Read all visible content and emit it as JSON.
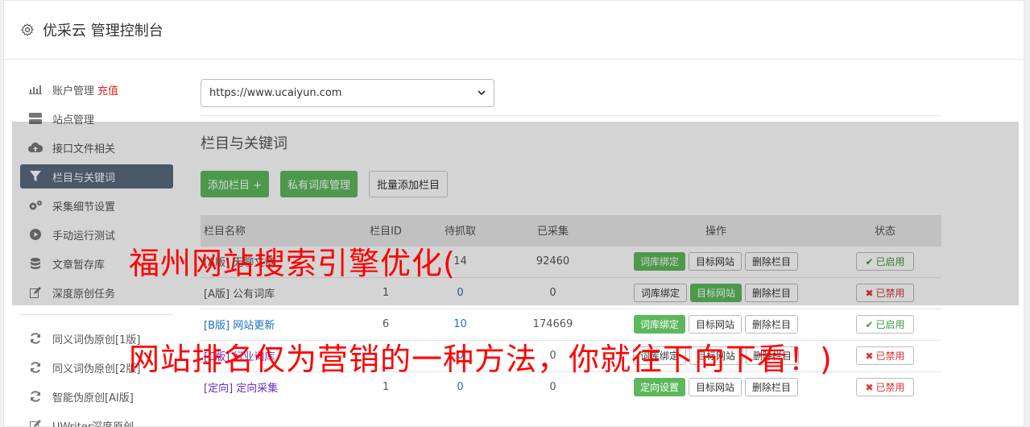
{
  "header": {
    "icon": "gear-icon",
    "title": "优采云 管理控制台"
  },
  "sidebar": {
    "items": [
      {
        "icon": "bar-chart-icon",
        "label": "账户管理",
        "accent": "充值",
        "active": false
      },
      {
        "icon": "server-icon",
        "label": "站点管理",
        "active": false
      },
      {
        "icon": "cloud-upload-icon",
        "label": "接口文件相关",
        "active": false
      },
      {
        "icon": "filter-icon",
        "label": "栏目与关键词",
        "active": true
      },
      {
        "icon": "cogs-icon",
        "label": "采集细节设置",
        "active": false
      },
      {
        "icon": "play-circle-icon",
        "label": "手动运行测试",
        "active": false
      },
      {
        "icon": "database-icon",
        "label": "文章暂存库",
        "active": false
      },
      {
        "icon": "edit-icon",
        "label": "深度原创任务",
        "active": false
      }
    ],
    "tools": [
      {
        "icon": "refresh-icon",
        "label": "同义词伪原创[1版]"
      },
      {
        "icon": "refresh-icon",
        "label": "同义词伪原创[2版]"
      },
      {
        "icon": "refresh-icon",
        "label": "智能伪原创[AI版]"
      },
      {
        "icon": "edit-icon",
        "label": "UWriter深度原创"
      }
    ]
  },
  "main": {
    "site_select": "https://www.ucaiyun.com",
    "section_title": "栏目与关键词",
    "buttons": {
      "add": "添加栏目 +",
      "private_lib": "私有词库管理",
      "batch_add": "批量添加栏目"
    },
    "table": {
      "headers": [
        "栏目名称",
        "栏目ID",
        "待抓取",
        "已采集",
        "操作",
        "状态"
      ],
      "rows": [
        {
          "name": "[A版] 无聊文章",
          "id": "",
          "pending": "14",
          "collected": "92460",
          "op1": "词库绑定",
          "op1_green": true,
          "op2": "目标网站",
          "op2_green": false,
          "op3": "删除栏目",
          "status": "已启用",
          "status_on": true,
          "name_color": "gray"
        },
        {
          "name": "[A版] 公有词库",
          "id": "1",
          "pending": "0",
          "collected": "0",
          "op1": "词库绑定",
          "op1_green": false,
          "op2": "目标网站",
          "op2_green": true,
          "op3": "删除栏目",
          "status": "已禁用",
          "status_on": false,
          "name_color": "gray"
        },
        {
          "name": "[B版] 网站更新",
          "id": "6",
          "pending": "10",
          "collected": "174669",
          "op1": "词库绑定",
          "op1_green": true,
          "op2": "目标网站",
          "op2_green": false,
          "op3": "删除栏目",
          "status": "已启用",
          "status_on": true,
          "name_color": "blue"
        },
        {
          "name": "[C版] 行业词库",
          "id": "",
          "pending": "0",
          "collected": "0",
          "op1": "词库绑定",
          "op1_green": false,
          "op2": "目标网站",
          "op2_green": false,
          "op3": "删除栏目",
          "status": "已禁用",
          "status_on": false,
          "name_color": "purple"
        },
        {
          "name": "[定向] 定向采集",
          "id": "1",
          "pending": "0",
          "collected": "0",
          "op1": "定向设置",
          "op1_green": true,
          "op2": "目标网站",
          "op2_green": false,
          "op3": "删除栏目",
          "status": "已禁用",
          "status_on": false,
          "name_color": "purple"
        }
      ]
    }
  },
  "promo": {
    "line1": "福州网站搜索引擎优化(",
    "line2": "网站排名仅为营销的一种方法，你就往下向下看！)"
  },
  "colors": {
    "green": "#5cb85c",
    "active_nav": "#5a6a80",
    "promo_red": "#ff0000"
  }
}
